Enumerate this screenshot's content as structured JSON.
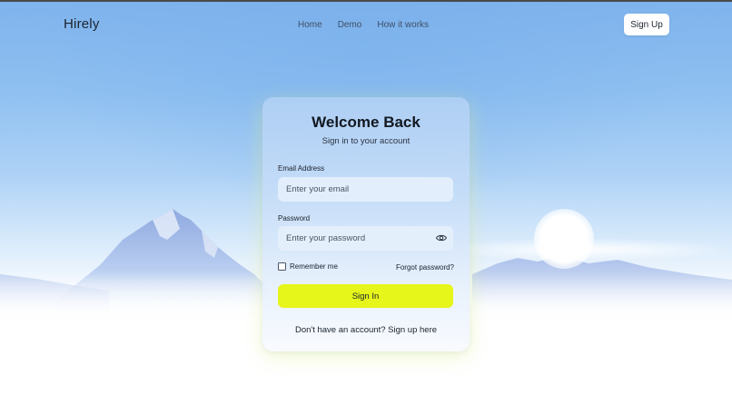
{
  "nav": {
    "logo": "Hirely",
    "links": [
      "Home",
      "Demo",
      "How it works"
    ],
    "signup_label": "Sign Up"
  },
  "card": {
    "title": "Welcome Back",
    "subtitle": "Sign in to your account",
    "email": {
      "label": "Email Address",
      "placeholder": "Enter your email",
      "value": ""
    },
    "password": {
      "label": "Password",
      "placeholder": "Enter your password",
      "value": "",
      "toggle_icon": "eye-icon"
    },
    "remember_label": "Remember me",
    "remember_checked": false,
    "forgot_label": "Forgot password?",
    "signin_label": "Sign In",
    "footer_prompt": "Don't have an account?",
    "footer_link": "Sign up here"
  },
  "colors": {
    "accent": "#e6f51a",
    "text": "#1a212c"
  }
}
